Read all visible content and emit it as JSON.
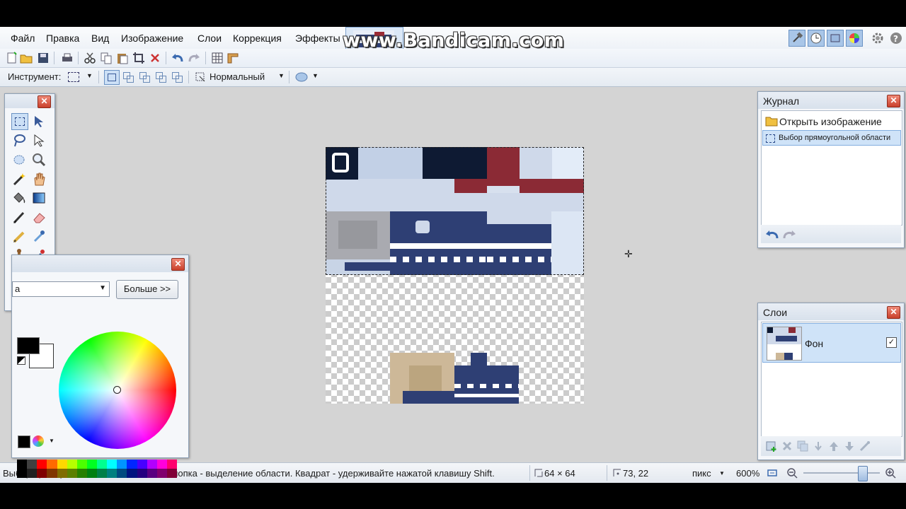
{
  "menu": [
    "Файл",
    "Правка",
    "Вид",
    "Изображение",
    "Слои",
    "Коррекция",
    "Эффекты"
  ],
  "watermark": "www.Bandicam.com",
  "toolbar": {
    "tool_label": "Инструмент:",
    "blend_mode": "Нормальный"
  },
  "colors_panel": {
    "dropdown_value": "а",
    "more_button": "Больше >>",
    "primary_color": "#000000",
    "secondary_color": "#ffffff"
  },
  "history_panel": {
    "title": "Журнал",
    "items": [
      "Открыть изображение",
      "Выбор прямоугольной области"
    ]
  },
  "layers_panel": {
    "title": "Слои",
    "layers": [
      {
        "name": "Фон",
        "visible": true
      }
    ]
  },
  "status": {
    "hint": "Выбор прямоугольной области. Левая кнопка - выделение области. Квадрат - удерживайте нажатой клавишу Shift.",
    "selection_size": "64 × 64",
    "cursor_pos": "73, 22",
    "units": "пикс",
    "zoom": "600%"
  },
  "accent": "#2e3f74",
  "palette": [
    "#000000",
    "#404040",
    "#ff0000",
    "#ff6a00",
    "#ffd800",
    "#b6ff00",
    "#4cff00",
    "#00ff21",
    "#00ff90",
    "#00ffff",
    "#0094ff",
    "#0026ff",
    "#4800ff",
    "#b200ff",
    "#ff00dc",
    "#ff006e"
  ]
}
